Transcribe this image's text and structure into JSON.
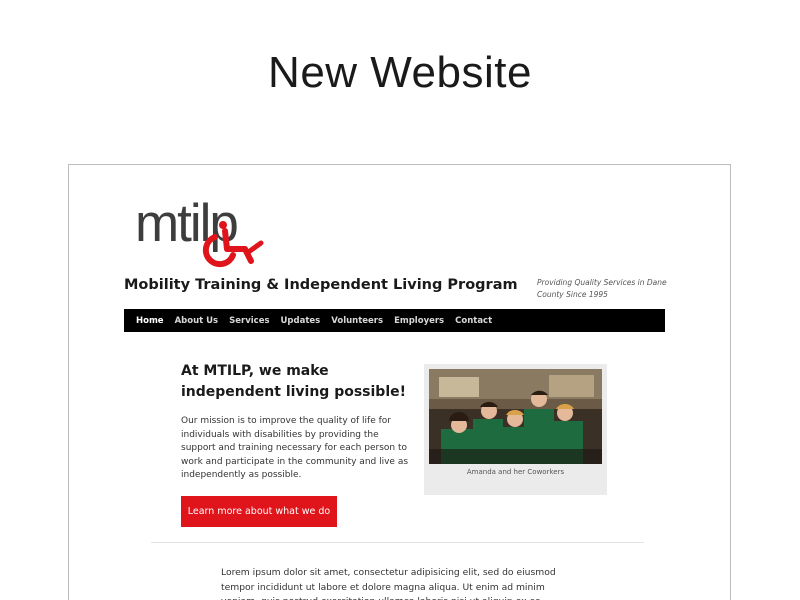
{
  "slide": {
    "title": "New Website"
  },
  "site": {
    "name": "Mobility Training & Independent Living Program",
    "tagline": "Providing Quality Services in Dane County Since 1995",
    "logo_text": "mtilp"
  },
  "nav": {
    "items": [
      {
        "label": "Home",
        "active": true
      },
      {
        "label": "About Us"
      },
      {
        "label": "Services"
      },
      {
        "label": "Updates"
      },
      {
        "label": "Volunteers"
      },
      {
        "label": "Employers"
      },
      {
        "label": "Contact"
      }
    ]
  },
  "hero": {
    "heading": "At MTILP, we make independent living possible!",
    "text": "Our mission is to improve the quality of life for individuals with disabilities by providing the support and training necessary for each person to work and participate in the community and live as independently as possible.",
    "button_label": "Learn more about what we do"
  },
  "photo": {
    "caption": "Amanda and her Coworkers"
  },
  "body": {
    "text": "Lorem ipsum dolor sit amet, consectetur adipisicing elit, sed do eiusmod tempor incididunt ut labore et dolore magna aliqua. Ut enim ad minim veniam, quis nostrud exercitation ullamco laboris nisi ut aliquip ex ea commodo"
  },
  "colors": {
    "accent": "#e0141b",
    "nav_bg": "#000000",
    "logo_dark": "#3d3d3d"
  },
  "icons": {
    "logo": "wheelchair-logo-icon"
  }
}
